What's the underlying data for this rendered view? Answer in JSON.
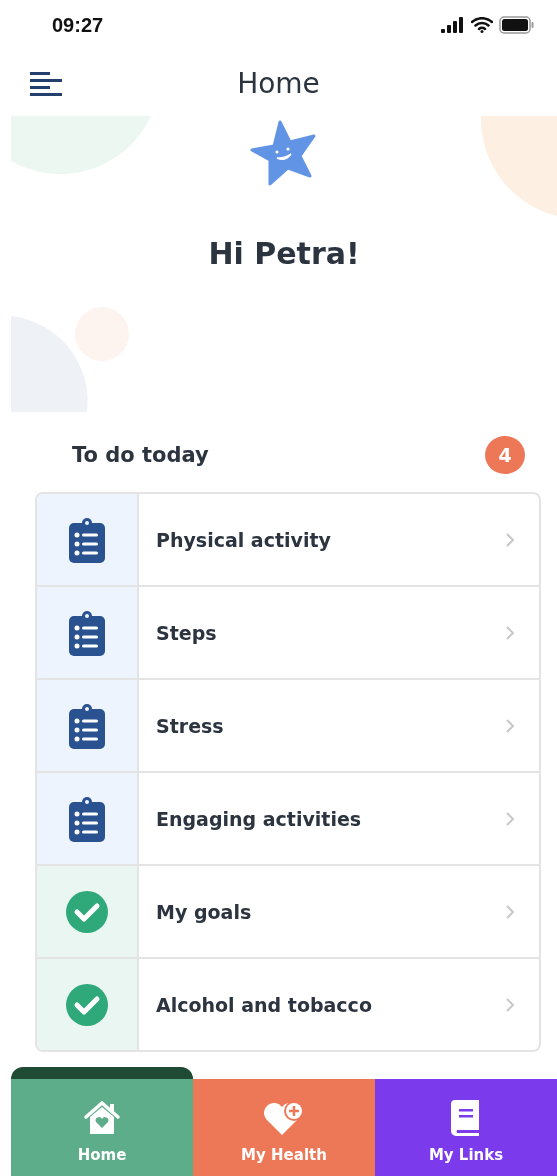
{
  "status_bar": {
    "time": "09:27"
  },
  "header": {
    "title": "Home"
  },
  "greeting": "Hi Petra!",
  "todo": {
    "title": "To do today",
    "count": "4"
  },
  "tasks": [
    {
      "label": "Physical activity",
      "kind": "todo"
    },
    {
      "label": "Steps",
      "kind": "todo"
    },
    {
      "label": "Stress",
      "kind": "todo"
    },
    {
      "label": "Engaging activities",
      "kind": "todo"
    },
    {
      "label": "My goals",
      "kind": "done"
    },
    {
      "label": "Alcohol and tobacco",
      "kind": "done"
    }
  ],
  "nav": [
    {
      "label": "Home",
      "kind": "home",
      "color": "#5dad8a",
      "selected": true
    },
    {
      "label": "My Health",
      "kind": "health",
      "color": "#ed7858",
      "selected": false
    },
    {
      "label": "My Links",
      "kind": "links",
      "color": "#7c3aed",
      "selected": false
    }
  ]
}
